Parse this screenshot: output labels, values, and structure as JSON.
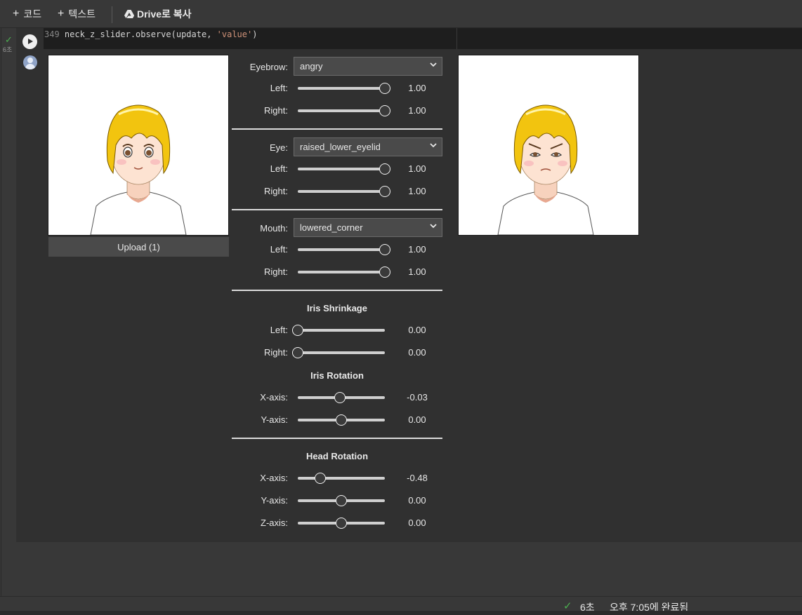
{
  "toolbar": {
    "add_code": "코드",
    "add_text": "텍스트",
    "copy_drive": "Drive로 복사"
  },
  "gutter": {
    "exec_time": "6초"
  },
  "code": {
    "line_number": "349",
    "before": " neck_z_slider.observe(update, ",
    "string": "'value'",
    "after": ")"
  },
  "upload": {
    "label": "Upload (1)"
  },
  "dropdowns": {
    "eyebrow": {
      "label": "Eyebrow:",
      "value": "angry"
    },
    "eye": {
      "label": "Eye:",
      "value": "raised_lower_eyelid"
    },
    "mouth": {
      "label": "Mouth:",
      "value": "lowered_corner"
    }
  },
  "sections": {
    "iris_shrinkage": "Iris Shrinkage",
    "iris_rotation": "Iris Rotation",
    "head_rotation": "Head Rotation"
  },
  "sliders": [
    {
      "id": "eyebrow-left",
      "label": "Left:",
      "value": "1.00",
      "frac": 1.0
    },
    {
      "id": "eyebrow-right",
      "label": "Right:",
      "value": "1.00",
      "frac": 1.0
    },
    {
      "id": "eye-left",
      "label": "Left:",
      "value": "1.00",
      "frac": 1.0
    },
    {
      "id": "eye-right",
      "label": "Right:",
      "value": "1.00",
      "frac": 1.0
    },
    {
      "id": "mouth-left",
      "label": "Left:",
      "value": "1.00",
      "frac": 1.0
    },
    {
      "id": "mouth-right",
      "label": "Right:",
      "value": "1.00",
      "frac": 1.0
    },
    {
      "id": "iris-shrink-left",
      "label": "Left:",
      "value": "0.00",
      "frac": 0.0
    },
    {
      "id": "iris-shrink-right",
      "label": "Right:",
      "value": "0.00",
      "frac": 0.0
    },
    {
      "id": "iris-rot-x",
      "label": "X-axis:",
      "value": "-0.03",
      "frac": 0.485
    },
    {
      "id": "iris-rot-y",
      "label": "Y-axis:",
      "value": "0.00",
      "frac": 0.5
    },
    {
      "id": "head-rot-x",
      "label": "X-axis:",
      "value": "-0.48",
      "frac": 0.26
    },
    {
      "id": "head-rot-y",
      "label": "Y-axis:",
      "value": "0.00",
      "frac": 0.5
    },
    {
      "id": "head-rot-z",
      "label": "Z-axis:",
      "value": "0.00",
      "frac": 0.5
    }
  ],
  "status": {
    "duration": "6초",
    "completed": "오후 7:05에 완료됨"
  },
  "colors": {
    "success": "#4caf50",
    "hair": "#f2c40f"
  }
}
